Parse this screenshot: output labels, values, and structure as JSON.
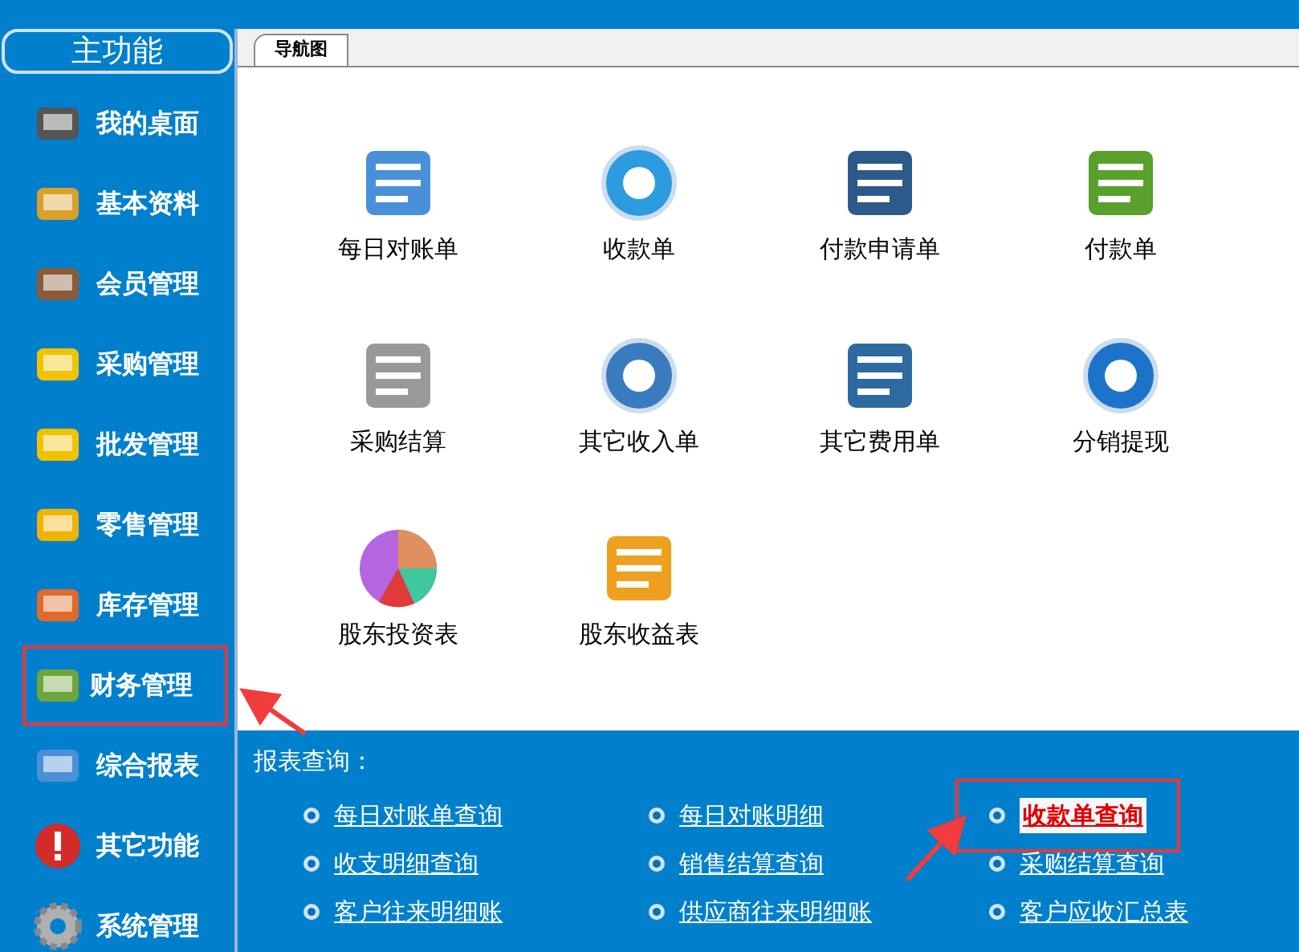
{
  "sidebar": {
    "title": "主功能",
    "items": [
      {
        "label": "我的桌面",
        "selected": false
      },
      {
        "label": "基本资料",
        "selected": false
      },
      {
        "label": "会员管理",
        "selected": false
      },
      {
        "label": "采购管理",
        "selected": false
      },
      {
        "label": "批发管理",
        "selected": false
      },
      {
        "label": "零售管理",
        "selected": false
      },
      {
        "label": "库存管理",
        "selected": false
      },
      {
        "label": "财务管理",
        "selected": true
      },
      {
        "label": "综合报表",
        "selected": false
      },
      {
        "label": "其它功能",
        "selected": false
      },
      {
        "label": "系统管理",
        "selected": false
      }
    ]
  },
  "tabs": [
    {
      "label": "导航图",
      "selected": true
    }
  ],
  "navigation": [
    {
      "label": "每日对账单"
    },
    {
      "label": "收款单"
    },
    {
      "label": "付款申请单"
    },
    {
      "label": "付款单"
    },
    {
      "label": "采购结算"
    },
    {
      "label": "其它收入单"
    },
    {
      "label": "其它费用单"
    },
    {
      "label": "分销提现"
    },
    {
      "label": "股东投资表"
    },
    {
      "label": "股东收益表"
    }
  ],
  "reports": {
    "title": "报表查询：",
    "links": [
      {
        "label": "每日对账单查询",
        "highlighted": false
      },
      {
        "label": "每日对账明细",
        "highlighted": false
      },
      {
        "label": "收款单查询",
        "highlighted": true
      },
      {
        "label": "收支明细查询",
        "highlighted": false
      },
      {
        "label": "销售结算查询",
        "highlighted": false
      },
      {
        "label": "采购结算查询",
        "highlighted": false
      },
      {
        "label": "客户往来明细账",
        "highlighted": false
      },
      {
        "label": "供应商往来明细账",
        "highlighted": false
      },
      {
        "label": "客户应收汇总表",
        "highlighted": false
      }
    ]
  }
}
